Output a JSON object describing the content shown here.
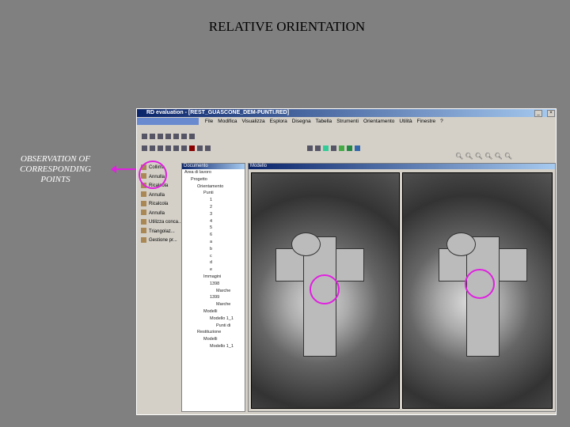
{
  "slide": {
    "title": "RELATIVE ORIENTATION",
    "note": "OBSERVATION OF CORRESPONDING POINTS"
  },
  "window": {
    "title": "RD evaluation - [REST_GUASCONE_DEM-PUNTI.RED]",
    "menu": [
      "File",
      "Modifica",
      "Visualizza",
      "Esplora",
      "Disegna",
      "Tabella",
      "Strumenti",
      "Orientamento",
      "Utilità",
      "Finestre",
      "?"
    ]
  },
  "tools": [
    "Collima",
    "Annulla",
    "Ricalcola",
    "Annulla",
    "Ricalcola",
    "Annulla",
    "Utilizza conca...",
    "Triangolaz...",
    "Gestione pr..."
  ],
  "document": {
    "header": "Documento",
    "tree": [
      "Area di lavoro",
      "Progetto",
      "Orientamento",
      "Punti",
      "1",
      "2",
      "3",
      "4",
      "5",
      "6",
      "a",
      "b",
      "c",
      "d",
      "e",
      "Immagini",
      "1398",
      "Marche",
      "1399",
      "Marche",
      "Modelli",
      "Modello 1_1",
      "Punti di",
      "Restituzione",
      "Modelli",
      "Modello 1_1"
    ]
  },
  "model": {
    "header": "Modello"
  }
}
